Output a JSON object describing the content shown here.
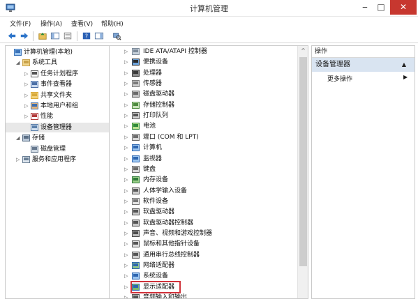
{
  "window": {
    "title": "计算机管理",
    "minimize": "‒",
    "maximize": "□",
    "close": "✕"
  },
  "menu": [
    "文件(F)",
    "操作(A)",
    "查看(V)",
    "帮助(H)"
  ],
  "left_tree": [
    {
      "label": "计算机管理(本地)",
      "level": 0,
      "arrow": "",
      "icon": "computer-management-icon"
    },
    {
      "label": "系统工具",
      "level": 1,
      "arrow": "◢",
      "icon": "system-tools-icon"
    },
    {
      "label": "任务计划程序",
      "level": 2,
      "arrow": "▷",
      "icon": "clock-icon"
    },
    {
      "label": "事件查看器",
      "level": 2,
      "arrow": "▷",
      "icon": "event-viewer-icon"
    },
    {
      "label": "共享文件夹",
      "level": 2,
      "arrow": "▷",
      "icon": "shared-folder-icon"
    },
    {
      "label": "本地用户和组",
      "level": 2,
      "arrow": "▷",
      "icon": "users-icon"
    },
    {
      "label": "性能",
      "level": 2,
      "arrow": "▷",
      "icon": "performance-icon"
    },
    {
      "label": "设备管理器",
      "level": 2,
      "arrow": "",
      "icon": "device-manager-icon",
      "selected": true
    },
    {
      "label": "存储",
      "level": 1,
      "arrow": "◢",
      "icon": "storage-icon"
    },
    {
      "label": "磁盘管理",
      "level": 2,
      "arrow": "",
      "icon": "disk-management-icon"
    },
    {
      "label": "服务和应用程序",
      "level": 1,
      "arrow": "▷",
      "icon": "services-icon"
    }
  ],
  "devices": [
    {
      "label": "IDE ATA/ATAPI 控制器",
      "icon": "ide-controller-icon"
    },
    {
      "label": "便携设备",
      "icon": "portable-device-icon"
    },
    {
      "label": "处理器",
      "icon": "processor-icon"
    },
    {
      "label": "传感器",
      "icon": "sensor-icon"
    },
    {
      "label": "磁盘驱动器",
      "icon": "disk-drive-icon"
    },
    {
      "label": "存储控制器",
      "icon": "storage-controller-icon"
    },
    {
      "label": "打印队列",
      "icon": "printer-icon"
    },
    {
      "label": "电池",
      "icon": "battery-icon"
    },
    {
      "label": "端口 (COM 和 LPT)",
      "icon": "port-icon"
    },
    {
      "label": "计算机",
      "icon": "computer-icon"
    },
    {
      "label": "监视器",
      "icon": "monitor-icon"
    },
    {
      "label": "键盘",
      "icon": "keyboard-icon"
    },
    {
      "label": "内存设备",
      "icon": "memory-icon"
    },
    {
      "label": "人体学输入设备",
      "icon": "hid-icon"
    },
    {
      "label": "软件设备",
      "icon": "software-device-icon"
    },
    {
      "label": "软盘驱动器",
      "icon": "floppy-drive-icon"
    },
    {
      "label": "软盘驱动器控制器",
      "icon": "floppy-controller-icon"
    },
    {
      "label": "声音、视频和游戏控制器",
      "icon": "sound-icon"
    },
    {
      "label": "鼠标和其他指针设备",
      "icon": "mouse-icon"
    },
    {
      "label": "通用串行总线控制器",
      "icon": "usb-icon"
    },
    {
      "label": "网络适配器",
      "icon": "network-adapter-icon"
    },
    {
      "label": "系统设备",
      "icon": "system-device-icon"
    },
    {
      "label": "显示适配器",
      "icon": "display-adapter-icon",
      "highlighted": true
    },
    {
      "label": "音频输入和输出",
      "icon": "audio-io-icon"
    }
  ],
  "actions": {
    "header": "操作",
    "section": "设备管理器",
    "section_caret": "▲",
    "more": "更多操作",
    "more_arrow": "▶"
  },
  "colors": {
    "highlight_border": "#d0323a",
    "action_section_bg": "#d9e4f1",
    "close_button": "#c7372f"
  }
}
